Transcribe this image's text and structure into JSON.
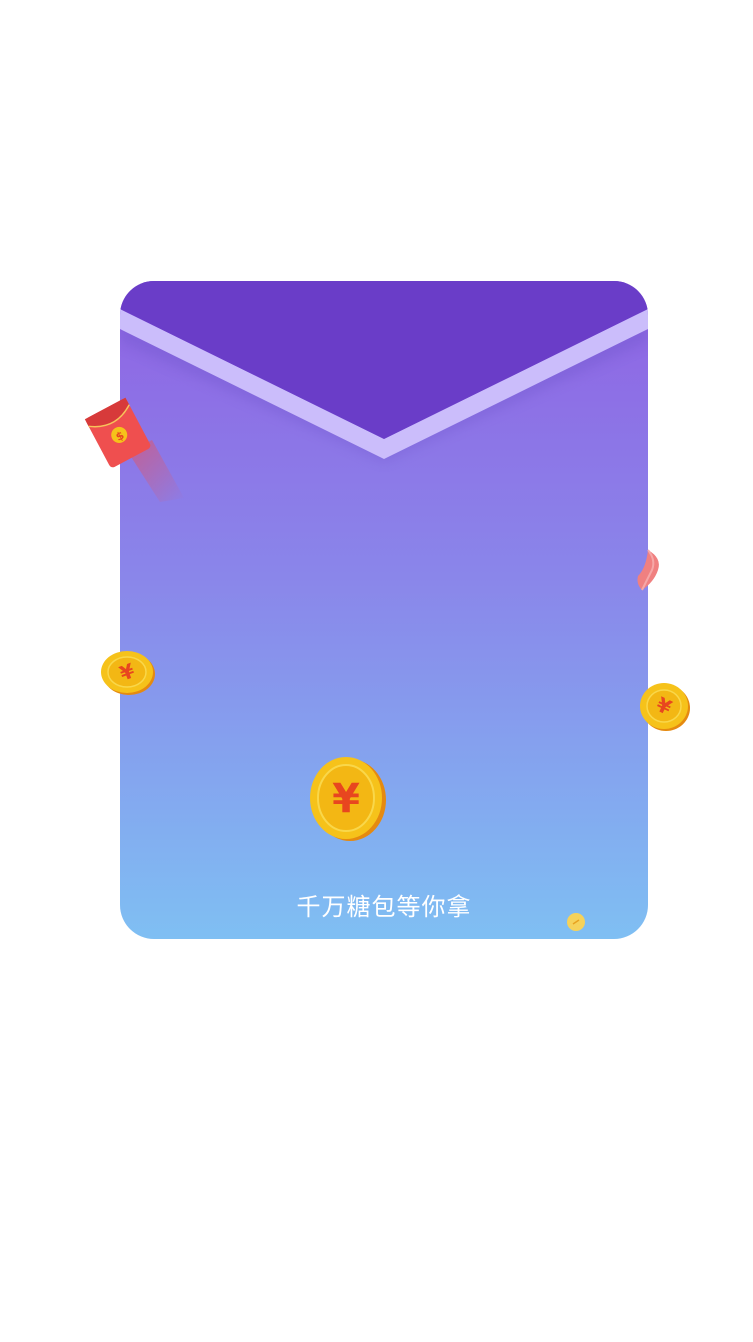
{
  "promo": {
    "caption": "千万糖包等你拿"
  },
  "colors": {
    "flap": "#6a3dc8",
    "flap_edge": "#cbbdfb",
    "gradient_top": "#8f62e3",
    "gradient_bottom": "#7fbff3",
    "coin": "#f6c21a",
    "coin_symbol": "#e8461f",
    "red_packet": "#ef4f4f"
  },
  "icons": {
    "coin": "yuan-coin-icon",
    "red_packet": "red-packet-icon",
    "ribbon": "ribbon-icon"
  }
}
